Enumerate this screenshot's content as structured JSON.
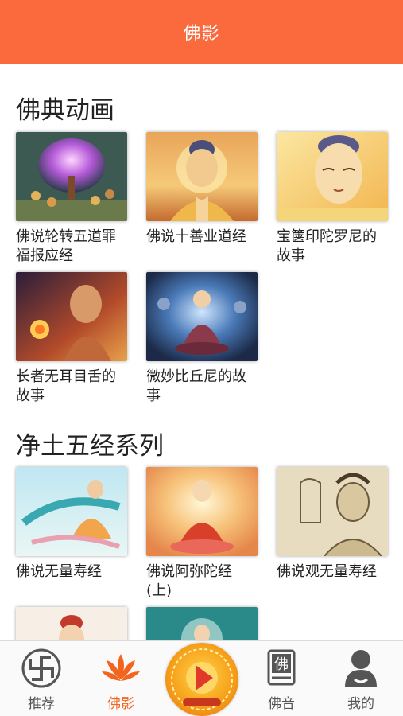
{
  "header": {
    "title": "佛影"
  },
  "sections": [
    {
      "title": "佛典动画",
      "items": [
        {
          "title": "佛说轮转五道罪福报应经",
          "thumb": "tree-of-light"
        },
        {
          "title": "佛说十善业道经",
          "thumb": "buddha-sunset"
        },
        {
          "title": "宝箧印陀罗尼的故事",
          "thumb": "buddha-portrait"
        },
        {
          "title": "长者无耳目舌的故事",
          "thumb": "elder-fire"
        },
        {
          "title": "微妙比丘尼的故事",
          "thumb": "nun-meditation"
        }
      ]
    },
    {
      "title": "净土五经系列",
      "items": [
        {
          "title": "佛说无量寿经",
          "thumb": "flying-apsara"
        },
        {
          "title": "佛说阿弥陀经(上)",
          "thumb": "amitabha-light"
        },
        {
          "title": "佛说观无量寿经",
          "thumb": "sketch-figure"
        },
        {
          "title": "",
          "thumb": "bodhisattva"
        },
        {
          "title": "",
          "thumb": "buddha-teal"
        }
      ]
    }
  ],
  "tabbar": {
    "tabs": [
      {
        "label": "推荐",
        "icon": "swastika-icon"
      },
      {
        "label": "佛影",
        "icon": "lotus-icon",
        "active": true
      },
      {
        "label": "",
        "icon": "play-center-icon"
      },
      {
        "label": "佛音",
        "icon": "scripture-icon"
      },
      {
        "label": "我的",
        "icon": "profile-icon"
      }
    ]
  },
  "colors": {
    "brand": "#fa6a3c",
    "active_tab": "#f3641e"
  }
}
